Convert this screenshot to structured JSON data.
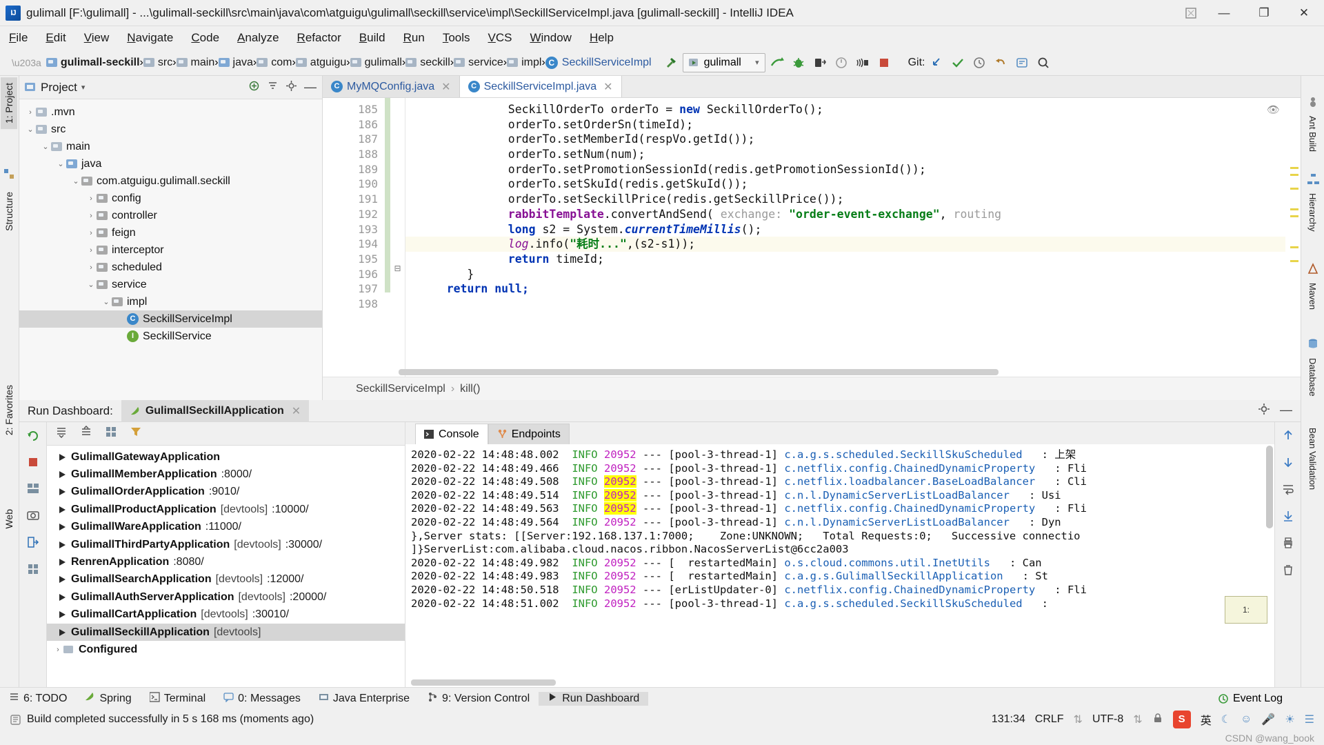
{
  "window": {
    "title": "gulimall [F:\\gulimall] - ...\\gulimall-seckill\\src\\main\\java\\com\\atguigu\\gulimall\\seckill\\service\\impl\\SeckillServiceImpl.java [gulimall-seckill] - IntelliJ IDEA",
    "logo_text": "IJ",
    "minimize": "—",
    "maximize": "❐",
    "close": "✕"
  },
  "menu": {
    "items": [
      "File",
      "Edit",
      "View",
      "Navigate",
      "Code",
      "Analyze",
      "Refactor",
      "Build",
      "Run",
      "Tools",
      "VCS",
      "Window",
      "Help"
    ]
  },
  "navbar": {
    "crumbs": [
      {
        "label": "gulimall-seckill",
        "icon": "module-folder-icon",
        "bold": true
      },
      {
        "label": "src",
        "icon": "folder-icon",
        "bold": false
      },
      {
        "label": "main",
        "icon": "folder-icon",
        "bold": false
      },
      {
        "label": "java",
        "icon": "source-root-folder-icon",
        "bold": false
      },
      {
        "label": "com",
        "icon": "package-folder-icon",
        "bold": false
      },
      {
        "label": "atguigu",
        "icon": "package-folder-icon",
        "bold": false
      },
      {
        "label": "gulimall",
        "icon": "package-folder-icon",
        "bold": false
      },
      {
        "label": "seckill",
        "icon": "package-folder-icon",
        "bold": false
      },
      {
        "label": "service",
        "icon": "package-folder-icon",
        "bold": false
      },
      {
        "label": "impl",
        "icon": "package-folder-icon",
        "bold": false
      },
      {
        "label": "SeckillServiceImpl",
        "icon": "class-icon",
        "bold": false
      }
    ],
    "run_config": "gulimall",
    "vcs_label": "Git:",
    "icons": [
      "hammer-icon",
      "run-icon",
      "debug-icon",
      "coverage-icon",
      "profile-icon",
      "attach-icon",
      "stop-icon",
      "update-project-icon",
      "commit-icon",
      "history-icon",
      "rollback-icon",
      "search-everywhere-icon",
      "settings-icon"
    ]
  },
  "left_strip": {
    "tabs": [
      "1: Project",
      "Structure",
      "2: Favorites",
      "Web"
    ]
  },
  "right_strip": {
    "tabs": [
      "Ant Build",
      "Hierarchy",
      "Maven",
      "Database",
      "Bean Validation"
    ]
  },
  "project_panel": {
    "title": "Project",
    "tools": [
      "expand-icon",
      "collapse-icon",
      "settings-icon",
      "hide-icon"
    ],
    "tree": [
      {
        "label": ".mvn",
        "depth": 2,
        "arrow": "›",
        "icon": "folder-icon",
        "selected": false
      },
      {
        "label": "src",
        "depth": 2,
        "arrow": "⌄",
        "icon": "folder-icon",
        "selected": false
      },
      {
        "label": "main",
        "depth": 3,
        "arrow": "⌄",
        "icon": "folder-icon",
        "selected": false
      },
      {
        "label": "java",
        "depth": 4,
        "arrow": "⌄",
        "icon": "source-root-folder-icon",
        "selected": false
      },
      {
        "label": "com.atguigu.gulimall.seckill",
        "depth": 5,
        "arrow": "⌄",
        "icon": "package-folder-icon",
        "selected": false
      },
      {
        "label": "config",
        "depth": 6,
        "arrow": "›",
        "icon": "package-folder-icon",
        "selected": false
      },
      {
        "label": "controller",
        "depth": 6,
        "arrow": "›",
        "icon": "package-folder-icon",
        "selected": false
      },
      {
        "label": "feign",
        "depth": 6,
        "arrow": "›",
        "icon": "package-folder-icon",
        "selected": false
      },
      {
        "label": "interceptor",
        "depth": 6,
        "arrow": "›",
        "icon": "package-folder-icon",
        "selected": false
      },
      {
        "label": "scheduled",
        "depth": 6,
        "arrow": "›",
        "icon": "package-folder-icon",
        "selected": false
      },
      {
        "label": "service",
        "depth": 6,
        "arrow": "⌄",
        "icon": "package-folder-icon",
        "selected": false
      },
      {
        "label": "impl",
        "depth": 7,
        "arrow": "⌄",
        "icon": "package-folder-icon",
        "selected": false
      },
      {
        "label": "SeckillServiceImpl",
        "depth": 8,
        "arrow": "",
        "icon": "class-icon",
        "selected": true
      },
      {
        "label": "SeckillService",
        "depth": 8,
        "arrow": "",
        "icon": "interface-icon",
        "selected": false
      }
    ]
  },
  "editor": {
    "tabs": [
      {
        "label": "MyMQConfig.java",
        "icon": "class-icon",
        "active": false,
        "close": "✕"
      },
      {
        "label": "SeckillServiceImpl.java",
        "icon": "class-icon",
        "active": true,
        "close": "✕"
      }
    ],
    "line_numbers": [
      "185",
      "186",
      "187",
      "188",
      "189",
      "190",
      "191",
      "192",
      "193",
      "194",
      "195",
      "196",
      "197",
      "198"
    ],
    "highlighted_line_index": 9,
    "breadcrumb": [
      "SeckillServiceImpl",
      "kill()"
    ],
    "code_lines": [
      [
        {
          "t": "SeckillOrderTo orderTo = ",
          "c": "cn"
        },
        {
          "t": "new",
          "c": "kw"
        },
        {
          "t": " SeckillOrderTo();",
          "c": "cn"
        }
      ],
      [
        {
          "t": "orderTo.setOrderSn(timeId);",
          "c": "cn"
        }
      ],
      [
        {
          "t": "orderTo.setMemberId(respVo.getId());",
          "c": "cn"
        }
      ],
      [
        {
          "t": "orderTo.setNum(num);",
          "c": "cn"
        }
      ],
      [
        {
          "t": "orderTo.setPromotionSessionId(redis.getPromotionSessionId());",
          "c": "cn"
        }
      ],
      [
        {
          "t": "orderTo.setSkuId(redis.getSkuId());",
          "c": "cn"
        }
      ],
      [
        {
          "t": "orderTo.setSeckillPrice(redis.getSeckillPrice());",
          "c": "cn"
        }
      ],
      [
        {
          "t": "rabbitTemplate",
          "c": "fld"
        },
        {
          "t": ".convertAndSend( ",
          "c": "cn"
        },
        {
          "t": "exchange:",
          "c": "hint"
        },
        {
          "t": " ",
          "c": "cn"
        },
        {
          "t": "\"order-event-exchange\"",
          "c": "str"
        },
        {
          "t": ", ",
          "c": "cn"
        },
        {
          "t": "routing",
          "c": "hint"
        }
      ],
      [
        {
          "t": "long",
          "c": "kw"
        },
        {
          "t": " s2 = System.",
          "c": "cn"
        },
        {
          "t": "currentTimeMillis",
          "c": "kw-it"
        },
        {
          "t": "();",
          "c": "cn"
        }
      ],
      [
        {
          "t": "log",
          "c": "fld-it"
        },
        {
          "t": ".info(",
          "c": "cn"
        },
        {
          "t": "\"耗时...\"",
          "c": "str"
        },
        {
          "t": ",(s2-s1));",
          "c": "cn"
        }
      ],
      [
        {
          "t": "return",
          "c": "kw"
        },
        {
          "t": " timeId;",
          "c": "cn"
        }
      ],
      [
        {
          "t": "}",
          "c": "cn"
        }
      ],
      [
        {
          "t": "return null;",
          "c": "kw"
        }
      ],
      [
        {
          "t": "",
          "c": "cn"
        }
      ]
    ],
    "code_indents": [
      12,
      12,
      12,
      12,
      12,
      12,
      12,
      12,
      12,
      12,
      12,
      6,
      3,
      0
    ]
  },
  "run_dashboard": {
    "label": "Run Dashboard:",
    "tab": "GulimallSeckillApplication",
    "tab_close": "✕",
    "toolbar_icons": [
      "rerun-icon",
      "stop-icon",
      "camera-icon",
      "exit-icon",
      "layout-icon",
      "filter-icon",
      "expand-all-icon",
      "collapse-all-icon",
      "group-icon"
    ],
    "services": [
      {
        "name": "GulimallGatewayApplication",
        "meta": "",
        "port": "",
        "selected": false
      },
      {
        "name": "GulimallMemberApplication",
        "meta": "",
        "port": ":8000/",
        "selected": false
      },
      {
        "name": "GulimallOrderApplication",
        "meta": "",
        "port": ":9010/",
        "selected": false
      },
      {
        "name": "GulimallProductApplication",
        "meta": "[devtools]",
        "port": ":10000/",
        "selected": false
      },
      {
        "name": "GulimallWareApplication",
        "meta": "",
        "port": ":11000/",
        "selected": false
      },
      {
        "name": "GulimallThirdPartyApplication",
        "meta": "[devtools]",
        "port": ":30000/",
        "selected": false
      },
      {
        "name": "RenrenApplication",
        "meta": "",
        "port": ":8080/",
        "selected": false
      },
      {
        "name": "GulimallSearchApplication",
        "meta": "[devtools]",
        "port": ":12000/",
        "selected": false
      },
      {
        "name": "GulimallAuthServerApplication",
        "meta": "[devtools]",
        "port": ":20000/",
        "selected": false
      },
      {
        "name": "GulimallCartApplication",
        "meta": "[devtools]",
        "port": ":30010/",
        "selected": false
      },
      {
        "name": "GulimallSeckillApplication",
        "meta": "[devtools]",
        "port": "",
        "selected": true
      },
      {
        "name": "Configured",
        "meta": "",
        "port": "",
        "selected": false,
        "is_group": true
      }
    ],
    "console_tabs": [
      {
        "label": "Console",
        "icon": "console-icon",
        "active": true
      },
      {
        "label": "Endpoints",
        "icon": "endpoints-icon",
        "active": false
      }
    ],
    "console_lines": [
      {
        "date": "2020-02-22 14:48:48.002",
        "level": "INFO",
        "pid": "20952",
        "dash": "---",
        "thread": "[pool-3-thread-1]",
        "logger": "c.a.g.s.scheduled.SeckillSkuScheduled",
        "sep": ":",
        "msg": "上架",
        "pid_hl": false
      },
      {
        "date": "2020-02-22 14:48:49.466",
        "level": "INFO",
        "pid": "20952",
        "dash": "---",
        "thread": "[pool-3-thread-1]",
        "logger": "c.netflix.config.ChainedDynamicProperty",
        "sep": ":",
        "msg": "Fli",
        "pid_hl": false
      },
      {
        "date": "2020-02-22 14:48:49.508",
        "level": "INFO",
        "pid": "20952",
        "dash": "---",
        "thread": "[pool-3-thread-1]",
        "logger": "c.netflix.loadbalancer.BaseLoadBalancer",
        "sep": ":",
        "msg": "Cli",
        "pid_hl": true
      },
      {
        "date": "2020-02-22 14:48:49.514",
        "level": "INFO",
        "pid": "20952",
        "dash": "---",
        "thread": "[pool-3-thread-1]",
        "logger": "c.n.l.DynamicServerListLoadBalancer",
        "sep": ":",
        "msg": "Usi",
        "pid_hl": true
      },
      {
        "date": "2020-02-22 14:48:49.563",
        "level": "INFO",
        "pid": "20952",
        "dash": "---",
        "thread": "[pool-3-thread-1]",
        "logger": "c.netflix.config.ChainedDynamicProperty",
        "sep": ":",
        "msg": "Fli",
        "pid_hl": true
      },
      {
        "date": "2020-02-22 14:48:49.564",
        "level": "INFO",
        "pid": "20952",
        "dash": "---",
        "thread": "[pool-3-thread-1]",
        "logger": "c.n.l.DynamicServerListLoadBalancer",
        "sep": ":",
        "msg": "Dyn",
        "pid_hl": false
      },
      {
        "raw": "},Server stats: [[Server:192.168.137.1:7000;    Zone:UNKNOWN;   Total Requests:0;   Successive connectio"
      },
      {
        "raw": "]}ServerList:com.alibaba.cloud.nacos.ribbon.NacosServerList@6cc2a003"
      },
      {
        "date": "2020-02-22 14:48:49.982",
        "level": "INFO",
        "pid": "20952",
        "dash": "---",
        "thread": "[  restartedMain]",
        "logger": "o.s.cloud.commons.util.InetUtils",
        "sep": ":",
        "msg": "Can",
        "pid_hl": false
      },
      {
        "date": "2020-02-22 14:48:49.983",
        "level": "INFO",
        "pid": "20952",
        "dash": "---",
        "thread": "[  restartedMain]",
        "logger": "c.a.g.s.GulimallSeckillApplication",
        "sep": ":",
        "msg": "St",
        "pid_hl": false
      },
      {
        "date": "2020-02-22 14:48:50.518",
        "level": "INFO",
        "pid": "20952",
        "dash": "---",
        "thread": "[erListUpdater-0]",
        "logger": "c.netflix.config.ChainedDynamicProperty",
        "sep": ":",
        "msg": "Fli",
        "pid_hl": false
      },
      {
        "date": "2020-02-22 14:48:51.002",
        "level": "INFO",
        "pid": "20952",
        "dash": "---",
        "thread": "[pool-3-thread-1]",
        "logger": "c.a.g.s.scheduled.SeckillSkuScheduled",
        "sep": ":",
        "msg": "",
        "pid_hl": false
      }
    ],
    "tooltip": "1:"
  },
  "bottom_bar": {
    "items": [
      {
        "label": "6: TODO",
        "icon": "todo-icon",
        "active": false
      },
      {
        "label": "Spring",
        "icon": "spring-icon",
        "active": false
      },
      {
        "label": "Terminal",
        "icon": "terminal-icon",
        "active": false
      },
      {
        "label": "0: Messages",
        "icon": "messages-icon",
        "active": false
      },
      {
        "label": "Java Enterprise",
        "icon": "java-enterprise-icon",
        "active": false
      },
      {
        "label": "9: Version Control",
        "icon": "version-control-icon",
        "active": false
      },
      {
        "label": "Run Dashboard",
        "icon": "run-dashboard-icon",
        "active": true
      }
    ],
    "event_log": "Event Log"
  },
  "status_bar": {
    "message": "Build completed successfully in 5 s 168 ms (moments ago)",
    "caret": "131:34",
    "line_sep": "CRLF",
    "encoding": "UTF-8",
    "ime_label": "英",
    "icons": [
      "lock-icon",
      "sogou-icon",
      "keyboard-icon",
      "moon-icon",
      "smiley-icon",
      "mic-icon",
      "globe-icon",
      "more-icon"
    ]
  },
  "watermark": "CSDN @wang_book",
  "colors": {
    "accent_blue": "#2c5aa0",
    "keyword": "#0033b3",
    "string": "#067d17",
    "field": "#871094",
    "info_green": "#2e9a2e",
    "pid_magenta": "#c020c0",
    "logger_blue": "#1a5fb4",
    "highlight_yellow": "#ffff00",
    "selected_row": "#d5d5d5"
  }
}
